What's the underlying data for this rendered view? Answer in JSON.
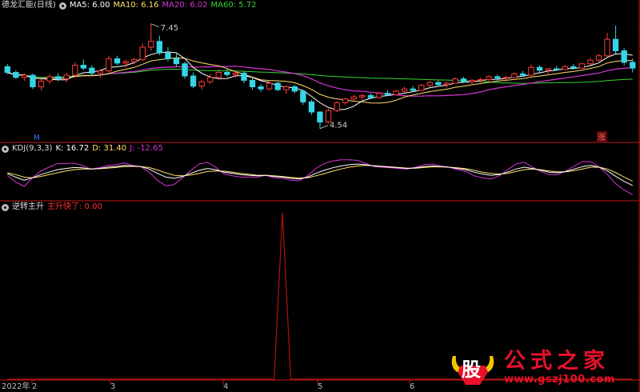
{
  "colors": {
    "up": "#ff3b3b",
    "down": "#36d4e6",
    "ma5": "#ffffff",
    "ma10": "#ffe066",
    "ma20": "#d535d5",
    "ma60": "#31d431",
    "kdj_k": "#ffffff",
    "kdj_d": "#ffe066",
    "kdj_j": "#d535d5",
    "signal": "#b11010",
    "grid": "#7a1010",
    "signal_label": "#ff3030"
  },
  "panels": {
    "price": {
      "title": "德龙汇能(日线)",
      "ma5_label": "MA5: 6.00",
      "ma10_label": "MA10: 6.16",
      "ma20_label": "MA20: 6.02",
      "ma60_label": "MA60: 5.72",
      "high_marker": "7.45",
      "low_marker": "4.54",
      "badge_left": "M",
      "badge_right": "涨"
    },
    "kdj": {
      "name": "KDJ(9,3,3)",
      "k_label": "K: 16.72",
      "d_label": "D: 31.40",
      "j_label": "J: -12.65"
    },
    "indicator": {
      "name": "逆转主升",
      "signal_label": "主升快了: 0.00"
    }
  },
  "xaxis": {
    "labels": [
      "2022年",
      "2",
      "3",
      "4",
      "5",
      "6"
    ]
  },
  "watermark": {
    "logo_char": "股",
    "text": "公式之家",
    "url": "www.gszj100.com"
  },
  "chart_data": [
    {
      "type": "candlestick",
      "title": "德龙汇能(日线)",
      "ylim": [
        4.2,
        7.8
      ],
      "high": 7.45,
      "low": 4.54,
      "series": [
        {
          "name": "MA5",
          "last": 6.0
        },
        {
          "name": "MA10",
          "last": 6.16
        },
        {
          "name": "MA20",
          "last": 6.02
        },
        {
          "name": "MA60",
          "last": 5.72
        }
      ],
      "ohlc": [
        [
          6.26,
          6.33,
          6.05,
          6.1
        ],
        [
          6.1,
          6.16,
          5.92,
          5.96
        ],
        [
          5.96,
          6.08,
          5.86,
          6.02
        ],
        [
          6.02,
          6.07,
          5.64,
          5.7
        ],
        [
          5.7,
          5.92,
          5.6,
          5.86
        ],
        [
          5.86,
          6.05,
          5.78,
          5.98
        ],
        [
          5.98,
          6.08,
          5.86,
          5.92
        ],
        [
          5.92,
          6.1,
          5.82,
          6.02
        ],
        [
          6.02,
          6.38,
          5.98,
          6.3
        ],
        [
          6.3,
          6.46,
          6.16,
          6.22
        ],
        [
          6.22,
          6.3,
          6.02,
          6.08
        ],
        [
          6.08,
          6.2,
          5.95,
          6.14
        ],
        [
          6.14,
          6.56,
          6.1,
          6.48
        ],
        [
          6.48,
          6.56,
          6.3,
          6.36
        ],
        [
          6.36,
          6.46,
          6.24,
          6.4
        ],
        [
          6.4,
          6.5,
          6.32,
          6.46
        ],
        [
          6.46,
          6.9,
          6.42,
          6.8
        ],
        [
          6.8,
          7.45,
          6.7,
          6.96
        ],
        [
          6.96,
          7.12,
          6.58,
          6.64
        ],
        [
          6.64,
          6.8,
          6.4,
          6.48
        ],
        [
          6.48,
          6.62,
          6.26,
          6.34
        ],
        [
          6.34,
          6.4,
          5.92,
          6.0
        ],
        [
          6.0,
          6.1,
          5.66,
          5.72
        ],
        [
          5.72,
          5.9,
          5.62,
          5.84
        ],
        [
          5.84,
          6.06,
          5.78,
          5.96
        ],
        [
          5.96,
          6.18,
          5.9,
          6.1
        ],
        [
          6.1,
          6.2,
          5.98,
          6.04
        ],
        [
          6.04,
          6.16,
          5.94,
          6.08
        ],
        [
          6.08,
          6.14,
          5.8,
          5.88
        ],
        [
          5.88,
          5.94,
          5.62,
          5.7
        ],
        [
          5.7,
          5.78,
          5.56,
          5.64
        ],
        [
          5.64,
          5.86,
          5.6,
          5.8
        ],
        [
          5.8,
          5.84,
          5.58,
          5.62
        ],
        [
          5.62,
          5.74,
          5.5,
          5.7
        ],
        [
          5.7,
          5.76,
          5.52,
          5.58
        ],
        [
          5.58,
          5.62,
          5.2,
          5.28
        ],
        [
          5.28,
          5.34,
          4.92,
          5.0
        ],
        [
          5.0,
          5.02,
          4.54,
          4.72
        ],
        [
          4.72,
          5.1,
          4.68,
          5.04
        ],
        [
          5.04,
          5.3,
          5.0,
          5.26
        ],
        [
          5.26,
          5.4,
          5.2,
          5.36
        ],
        [
          5.36,
          5.48,
          5.3,
          5.42
        ],
        [
          5.42,
          5.5,
          5.34,
          5.46
        ],
        [
          5.46,
          5.52,
          5.36,
          5.4
        ],
        [
          5.4,
          5.56,
          5.38,
          5.52
        ],
        [
          5.52,
          5.6,
          5.44,
          5.48
        ],
        [
          5.48,
          5.62,
          5.46,
          5.58
        ],
        [
          5.58,
          5.7,
          5.52,
          5.64
        ],
        [
          5.64,
          5.72,
          5.56,
          5.6
        ],
        [
          5.6,
          5.78,
          5.58,
          5.74
        ],
        [
          5.74,
          5.86,
          5.7,
          5.82
        ],
        [
          5.82,
          5.88,
          5.7,
          5.76
        ],
        [
          5.76,
          5.84,
          5.68,
          5.8
        ],
        [
          5.8,
          5.96,
          5.78,
          5.92
        ],
        [
          5.92,
          5.98,
          5.8,
          5.84
        ],
        [
          5.84,
          5.92,
          5.74,
          5.88
        ],
        [
          5.88,
          5.96,
          5.82,
          5.9
        ],
        [
          5.9,
          6.02,
          5.86,
          5.98
        ],
        [
          5.98,
          6.04,
          5.88,
          5.94
        ],
        [
          5.94,
          6.0,
          5.84,
          5.96
        ],
        [
          5.96,
          6.1,
          5.94,
          6.06
        ],
        [
          6.06,
          6.14,
          5.98,
          6.02
        ],
        [
          6.02,
          6.32,
          6.0,
          6.24
        ],
        [
          6.24,
          6.3,
          6.1,
          6.16
        ],
        [
          6.16,
          6.22,
          6.06,
          6.2
        ],
        [
          6.2,
          6.28,
          6.14,
          6.18
        ],
        [
          6.18,
          6.3,
          6.16,
          6.26
        ],
        [
          6.26,
          6.34,
          6.18,
          6.22
        ],
        [
          6.22,
          6.36,
          6.2,
          6.34
        ],
        [
          6.34,
          6.5,
          6.3,
          6.44
        ],
        [
          6.44,
          6.62,
          6.4,
          6.56
        ],
        [
          6.56,
          7.2,
          6.54,
          7.02
        ],
        [
          7.02,
          7.4,
          6.62,
          6.7
        ],
        [
          6.7,
          6.78,
          6.3,
          6.38
        ],
        [
          6.38,
          6.48,
          6.1,
          6.22
        ]
      ]
    },
    {
      "type": "line",
      "title": "KDJ(9,3,3)",
      "ylim": [
        -30,
        120
      ],
      "series": [
        {
          "name": "K",
          "last": 16.72,
          "values": [
            55,
            44,
            34,
            42,
            52,
            60,
            68,
            72,
            75,
            74,
            70,
            72,
            76,
            78,
            82,
            80,
            78,
            70,
            56,
            44,
            40,
            46,
            56,
            66,
            72,
            68,
            60,
            56,
            52,
            50,
            48,
            50,
            46,
            44,
            40,
            38,
            44,
            56,
            66,
            74,
            80,
            84,
            86,
            84,
            80,
            78,
            76,
            74,
            72,
            74,
            78,
            80,
            78,
            76,
            72,
            68,
            60,
            54,
            50,
            52,
            60,
            70,
            76,
            72,
            66,
            60,
            58,
            62,
            70,
            78,
            82,
            76,
            64,
            46,
            30,
            17
          ]
        },
        {
          "name": "D",
          "last": 31.4,
          "values": [
            58,
            52,
            44,
            42,
            46,
            52,
            58,
            64,
            68,
            70,
            70,
            71,
            73,
            75,
            78,
            79,
            78,
            75,
            67,
            58,
            50,
            48,
            51,
            56,
            62,
            64,
            63,
            60,
            56,
            53,
            50,
            50,
            48,
            46,
            43,
            41,
            42,
            48,
            55,
            63,
            70,
            76,
            80,
            82,
            81,
            79,
            77,
            75,
            73,
            73,
            75,
            77,
            77,
            76,
            74,
            71,
            66,
            60,
            56,
            54,
            56,
            62,
            68,
            70,
            68,
            64,
            61,
            61,
            65,
            70,
            76,
            76,
            70,
            58,
            44,
            31
          ]
        },
        {
          "name": "J",
          "last": -12.65,
          "values": [
            49,
            28,
            14,
            42,
            64,
            76,
            88,
            88,
            89,
            82,
            70,
            74,
            82,
            84,
            90,
            82,
            78,
            60,
            34,
            16,
            20,
            42,
            66,
            86,
            92,
            76,
            54,
            48,
            44,
            44,
            44,
            50,
            42,
            40,
            34,
            32,
            48,
            72,
            88,
            96,
            100,
            100,
            98,
            88,
            78,
            76,
            74,
            72,
            70,
            76,
            84,
            86,
            80,
            76,
            68,
            62,
            48,
            42,
            38,
            48,
            68,
            86,
            92,
            76,
            62,
            52,
            52,
            64,
            80,
            94,
            94,
            76,
            52,
            22,
            2,
            -13
          ]
        }
      ]
    },
    {
      "type": "line",
      "title": "逆转主升",
      "ylim": [
        0,
        1
      ],
      "series": [
        {
          "name": "主升快了",
          "last": 0.0,
          "values": [
            0,
            0,
            0,
            0,
            0,
            0,
            0,
            0,
            0,
            0,
            0,
            0,
            0,
            0,
            0,
            0,
            0,
            0,
            0,
            0,
            0,
            0,
            0,
            0,
            0,
            0,
            0,
            0,
            0,
            0,
            0,
            0,
            0,
            0,
            0,
            0,
            0,
            0,
            0,
            0,
            0,
            0,
            0,
            0,
            0,
            0,
            0,
            0,
            0,
            0,
            0,
            0,
            0,
            0,
            0,
            0,
            0,
            0,
            0,
            0,
            0,
            0,
            0,
            0,
            0,
            0,
            0,
            0,
            0,
            0,
            0,
            0,
            0,
            0,
            0,
            0
          ]
        }
      ],
      "spike": {
        "index": 33,
        "value": 1
      }
    }
  ]
}
